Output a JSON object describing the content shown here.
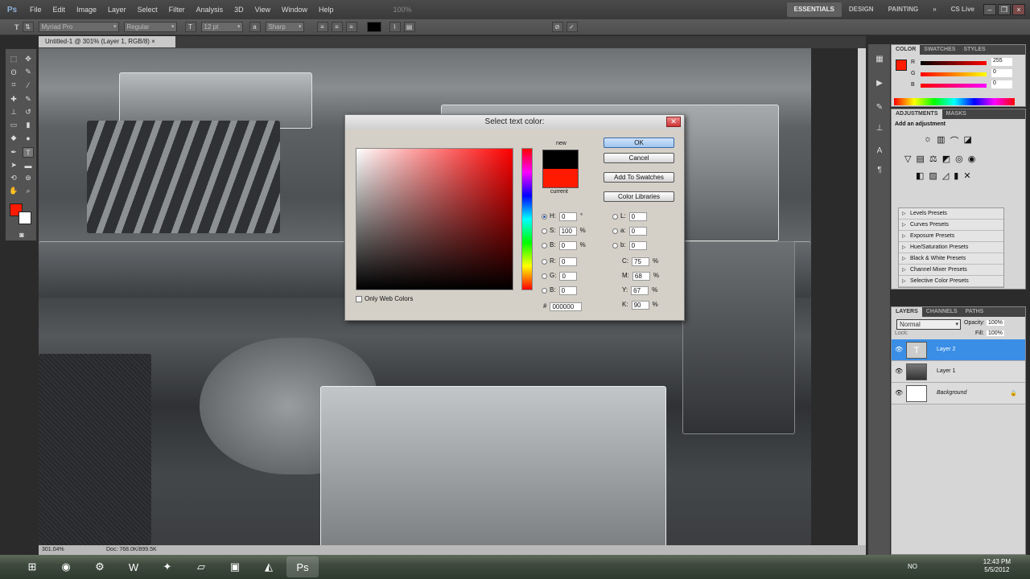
{
  "app": {
    "logo": "Ps"
  },
  "menu": [
    "File",
    "Edit",
    "Image",
    "Layer",
    "Select",
    "Filter",
    "Analysis",
    "3D",
    "View",
    "Window",
    "Help"
  ],
  "menu_zoom": "100%",
  "workspaces": [
    "ESSENTIALS",
    "DESIGN",
    "PAINTING"
  ],
  "cs_live": "CS Live",
  "options": {
    "font_family": "Myriad Pro",
    "font_style": "Regular",
    "font_size": "12 pt",
    "antialias": "Sharp"
  },
  "doc_tab": "Untitled-1 @ 301% (Layer 1, RGB/8) ×",
  "status": {
    "zoom": "301.04%",
    "doc": "Doc: 768.0K/899.5K"
  },
  "color_panel": {
    "tabs": [
      "COLOR",
      "SWATCHES",
      "STYLES"
    ],
    "r": "255",
    "g": "0",
    "b": "0",
    "labels": [
      "R",
      "G",
      "B"
    ]
  },
  "adjustments_panel": {
    "tabs": [
      "ADJUSTMENTS",
      "MASKS"
    ],
    "title": "Add an adjustment",
    "presets": [
      "Levels Presets",
      "Curves Presets",
      "Exposure Presets",
      "Hue/Saturation Presets",
      "Black & White Presets",
      "Channel Mixer Presets",
      "Selective Color Presets"
    ]
  },
  "layers_panel": {
    "tabs": [
      "LAYERS",
      "CHANNELS",
      "PATHS"
    ],
    "blend": "Normal",
    "opacity_label": "Opacity:",
    "opacity": "100%",
    "lock_label": "Lock:",
    "fill_label": "Fill:",
    "fill": "100%",
    "layers": [
      {
        "name": "Layer 2",
        "type": "text"
      },
      {
        "name": "Layer 1",
        "type": "image"
      },
      {
        "name": "Background",
        "type": "bg"
      }
    ]
  },
  "dialog": {
    "title": "Select text color:",
    "new_label": "new",
    "current_label": "current",
    "buttons": {
      "ok": "OK",
      "cancel": "Cancel",
      "add": "Add To Swatches",
      "libraries": "Color Libraries"
    },
    "hsb": [
      {
        "l": "H:",
        "v": "0",
        "u": "°"
      },
      {
        "l": "S:",
        "v": "100",
        "u": "%"
      },
      {
        "l": "B:",
        "v": "0",
        "u": "%"
      }
    ],
    "rgb": [
      {
        "l": "R:",
        "v": "0"
      },
      {
        "l": "G:",
        "v": "0"
      },
      {
        "l": "B:",
        "v": "0"
      }
    ],
    "lab": [
      {
        "l": "L:",
        "v": "0"
      },
      {
        "l": "a:",
        "v": "0"
      },
      {
        "l": "b:",
        "v": "0"
      }
    ],
    "cmyk": [
      {
        "l": "C:",
        "v": "75",
        "u": "%"
      },
      {
        "l": "M:",
        "v": "68",
        "u": "%"
      },
      {
        "l": "Y:",
        "v": "67",
        "u": "%"
      },
      {
        "l": "K:",
        "v": "90",
        "u": "%"
      }
    ],
    "hex_label": "#",
    "hex": "000000",
    "web_only": "Only Web Colors",
    "colors": {
      "new": "#000000",
      "current": "#ff1a00"
    }
  },
  "taskbar": {
    "lang": "NO",
    "time": "12:43 PM",
    "date": "5/5/2012"
  }
}
